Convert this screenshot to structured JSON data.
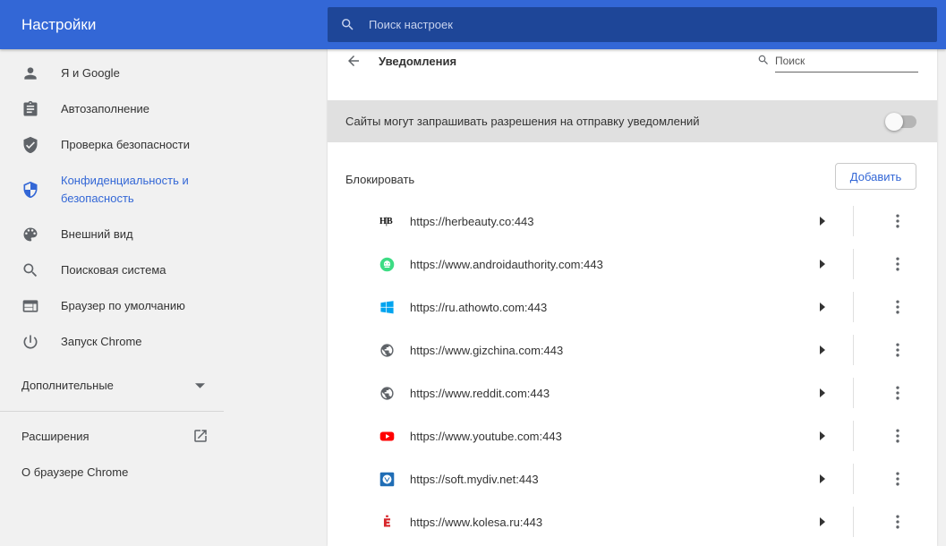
{
  "header": {
    "title": "Настройки",
    "search_placeholder": "Поиск настроек"
  },
  "sidebar": {
    "items": [
      {
        "label": "Я и Google",
        "icon": "person-icon"
      },
      {
        "label": "Автозаполнение",
        "icon": "clipboard-icon"
      },
      {
        "label": "Проверка безопасности",
        "icon": "shield-check-icon"
      },
      {
        "label": "Конфиденциальность и безопасность",
        "icon": "shield-icon",
        "active": true
      },
      {
        "label": "Внешний вид",
        "icon": "palette-icon"
      },
      {
        "label": "Поисковая система",
        "icon": "search-icon"
      },
      {
        "label": "Браузер по умолчанию",
        "icon": "browser-window-icon"
      },
      {
        "label": "Запуск Chrome",
        "icon": "power-icon"
      }
    ],
    "advanced_label": "Дополнительные",
    "extensions_label": "Расширения",
    "about_label": "О браузере Chrome"
  },
  "notifications": {
    "title": "Уведомления",
    "search_placeholder": "Поиск",
    "toggle_label": "Сайты могут запрашивать разрешения на отправку уведомлений",
    "toggle_on": false,
    "block_label": "Блокировать",
    "add_button": "Добавить",
    "sites": [
      {
        "url": "https://herbeauty.co:443",
        "favicon": "herbeauty-logo-icon",
        "favicon_text": "H|B"
      },
      {
        "url": "https://www.androidauthority.com:443",
        "favicon": "androidauthority-logo-icon"
      },
      {
        "url": "https://ru.athowto.com:443",
        "favicon": "windows-logo-icon"
      },
      {
        "url": "https://www.gizchina.com:443",
        "favicon": "globe-icon"
      },
      {
        "url": "https://www.reddit.com:443",
        "favicon": "globe-icon"
      },
      {
        "url": "https://www.youtube.com:443",
        "favicon": "youtube-logo-icon"
      },
      {
        "url": "https://soft.mydiv.net:443",
        "favicon": "mydiv-logo-icon"
      },
      {
        "url": "https://www.kolesa.ru:443",
        "favicon": "kolesa-logo-icon"
      }
    ]
  },
  "colors": {
    "accent": "#3367d6",
    "search_bg": "#1e4698",
    "page_bg": "#f1f1f1",
    "toggle_row_bg": "#e0e0e0"
  }
}
